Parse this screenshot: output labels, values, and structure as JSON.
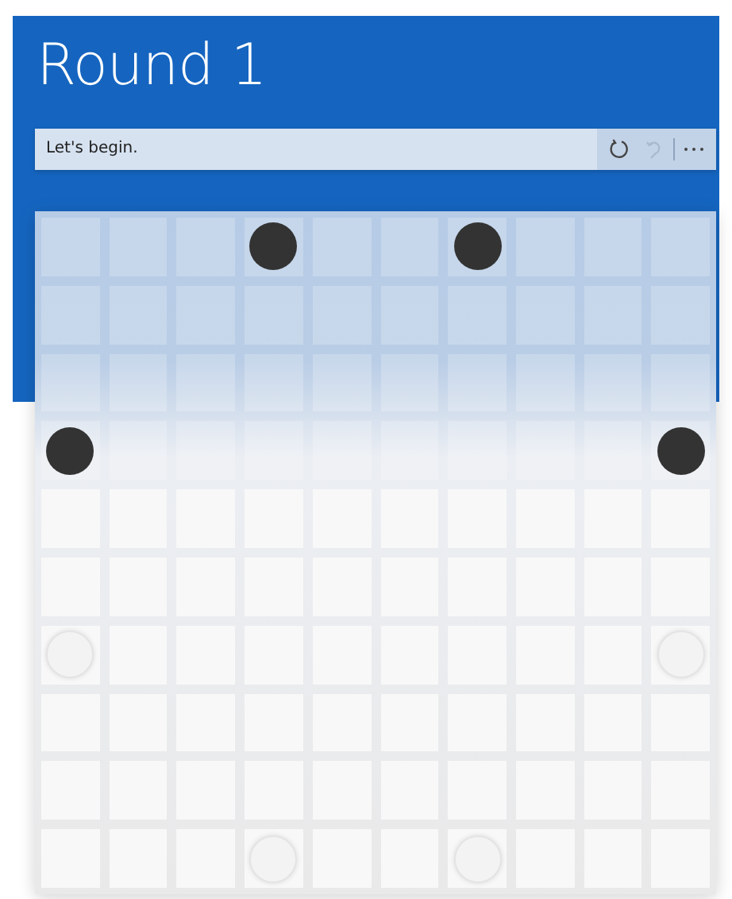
{
  "title": "Round 1",
  "message": "Let's begin.",
  "buttons": [
    {
      "kind": "reset",
      "disabled": false
    },
    {
      "kind": "undo",
      "disabled": true
    },
    {
      "kind": "more",
      "disabled": false
    }
  ],
  "board": {
    "rows": [
      [
        {
          "kind": "empty"
        },
        {
          "kind": "empty"
        },
        {
          "kind": "empty"
        },
        {
          "kind": "dark"
        },
        {
          "kind": "empty"
        },
        {
          "kind": "empty"
        },
        {
          "kind": "dark"
        },
        {
          "kind": "empty"
        },
        {
          "kind": "empty"
        },
        {
          "kind": "empty"
        }
      ],
      [
        {
          "kind": "empty"
        },
        {
          "kind": "empty"
        },
        {
          "kind": "empty"
        },
        {
          "kind": "empty"
        },
        {
          "kind": "empty"
        },
        {
          "kind": "empty"
        },
        {
          "kind": "empty"
        },
        {
          "kind": "empty"
        },
        {
          "kind": "empty"
        },
        {
          "kind": "empty"
        }
      ],
      [
        {
          "kind": "empty"
        },
        {
          "kind": "empty"
        },
        {
          "kind": "empty"
        },
        {
          "kind": "empty"
        },
        {
          "kind": "empty"
        },
        {
          "kind": "empty"
        },
        {
          "kind": "empty"
        },
        {
          "kind": "empty"
        },
        {
          "kind": "empty"
        },
        {
          "kind": "empty"
        }
      ],
      [
        {
          "kind": "dark"
        },
        {
          "kind": "empty"
        },
        {
          "kind": "empty"
        },
        {
          "kind": "empty"
        },
        {
          "kind": "empty"
        },
        {
          "kind": "empty"
        },
        {
          "kind": "empty"
        },
        {
          "kind": "empty"
        },
        {
          "kind": "empty"
        },
        {
          "kind": "dark"
        }
      ],
      [
        {
          "kind": "empty"
        },
        {
          "kind": "empty"
        },
        {
          "kind": "empty"
        },
        {
          "kind": "empty"
        },
        {
          "kind": "empty"
        },
        {
          "kind": "empty"
        },
        {
          "kind": "empty"
        },
        {
          "kind": "empty"
        },
        {
          "kind": "empty"
        },
        {
          "kind": "empty"
        }
      ],
      [
        {
          "kind": "empty"
        },
        {
          "kind": "empty"
        },
        {
          "kind": "empty"
        },
        {
          "kind": "empty"
        },
        {
          "kind": "empty"
        },
        {
          "kind": "empty"
        },
        {
          "kind": "empty"
        },
        {
          "kind": "empty"
        },
        {
          "kind": "empty"
        },
        {
          "kind": "empty"
        }
      ],
      [
        {
          "kind": "light"
        },
        {
          "kind": "empty"
        },
        {
          "kind": "empty"
        },
        {
          "kind": "empty"
        },
        {
          "kind": "empty"
        },
        {
          "kind": "empty"
        },
        {
          "kind": "empty"
        },
        {
          "kind": "empty"
        },
        {
          "kind": "empty"
        },
        {
          "kind": "light"
        }
      ],
      [
        {
          "kind": "empty"
        },
        {
          "kind": "empty"
        },
        {
          "kind": "empty"
        },
        {
          "kind": "empty"
        },
        {
          "kind": "empty"
        },
        {
          "kind": "empty"
        },
        {
          "kind": "empty"
        },
        {
          "kind": "empty"
        },
        {
          "kind": "empty"
        },
        {
          "kind": "empty"
        }
      ],
      [
        {
          "kind": "empty"
        },
        {
          "kind": "empty"
        },
        {
          "kind": "empty"
        },
        {
          "kind": "empty"
        },
        {
          "kind": "empty"
        },
        {
          "kind": "empty"
        },
        {
          "kind": "empty"
        },
        {
          "kind": "empty"
        },
        {
          "kind": "empty"
        },
        {
          "kind": "empty"
        }
      ],
      [
        {
          "kind": "empty"
        },
        {
          "kind": "empty"
        },
        {
          "kind": "empty"
        },
        {
          "kind": "light"
        },
        {
          "kind": "empty"
        },
        {
          "kind": "empty"
        },
        {
          "kind": "light"
        },
        {
          "kind": "empty"
        },
        {
          "kind": "empty"
        },
        {
          "kind": "empty"
        }
      ]
    ]
  }
}
